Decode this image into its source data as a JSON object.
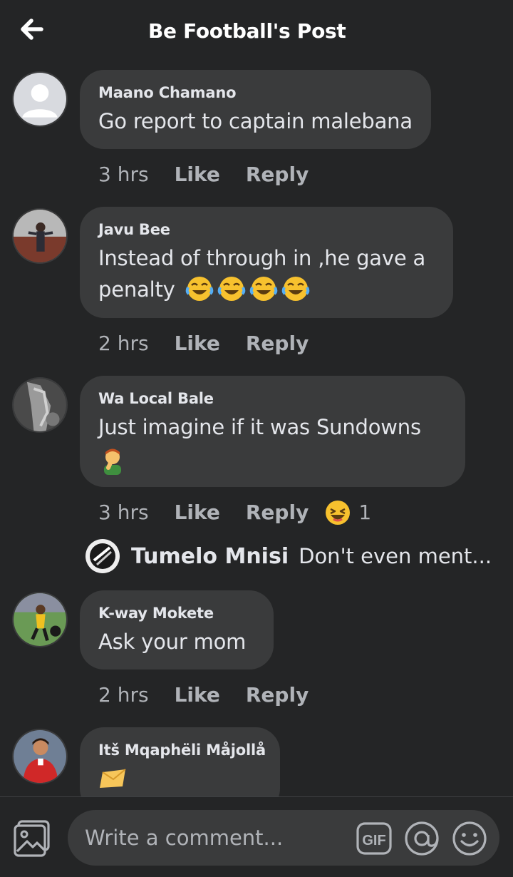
{
  "header": {
    "title": "Be Football's Post",
    "back_icon": "arrow-left-icon"
  },
  "comments": [
    {
      "author": "Maano Chamano",
      "text": "Go report to captain malebana",
      "time": "3 hrs",
      "like_label": "Like",
      "reply_label": "Reply",
      "avatar": "default-avatar"
    },
    {
      "author": "Javu Bee",
      "text": "Instead of through in ,he gave a penalty",
      "emojis": [
        "face-with-tears-of-joy",
        "face-with-tears-of-joy",
        "face-with-tears-of-joy",
        "face-with-tears-of-joy"
      ],
      "time": "2 hrs",
      "like_label": "Like",
      "reply_label": "Reply",
      "avatar": "photo-avatar"
    },
    {
      "author": "Wa Local Bale",
      "text": "Just imagine if it was Sundowns",
      "emojis": [
        "man-facepalming"
      ],
      "time": "3 hrs",
      "like_label": "Like",
      "reply_label": "Reply",
      "reaction": {
        "icon": "haha-reaction-icon",
        "count": "1"
      },
      "avatar": "photo-avatar",
      "reply_preview": {
        "author": "Tumelo Mnisi",
        "text": "Don't even ment..."
      }
    },
    {
      "author": "K-way Mokete",
      "text": "Ask your mom",
      "time": "2 hrs",
      "like_label": "Like",
      "reply_label": "Reply",
      "avatar": "photo-avatar"
    },
    {
      "author": "Itš Mqaphëli Måjollå",
      "text": "",
      "emojis": [
        "envelope"
      ],
      "avatar": "photo-avatar"
    }
  ],
  "composer": {
    "placeholder": "Write a comment...",
    "photo_icon": "photo-gallery-icon",
    "gif_label": "GIF",
    "at_icon": "at-mention-icon",
    "emoji_icon": "smiley-icon"
  },
  "colors": {
    "background": "#242526",
    "bubble": "#3a3b3c",
    "text_primary": "#e4e6eb",
    "text_secondary": "#b0b3b8",
    "emoji_yellow": "#f7c12e"
  }
}
